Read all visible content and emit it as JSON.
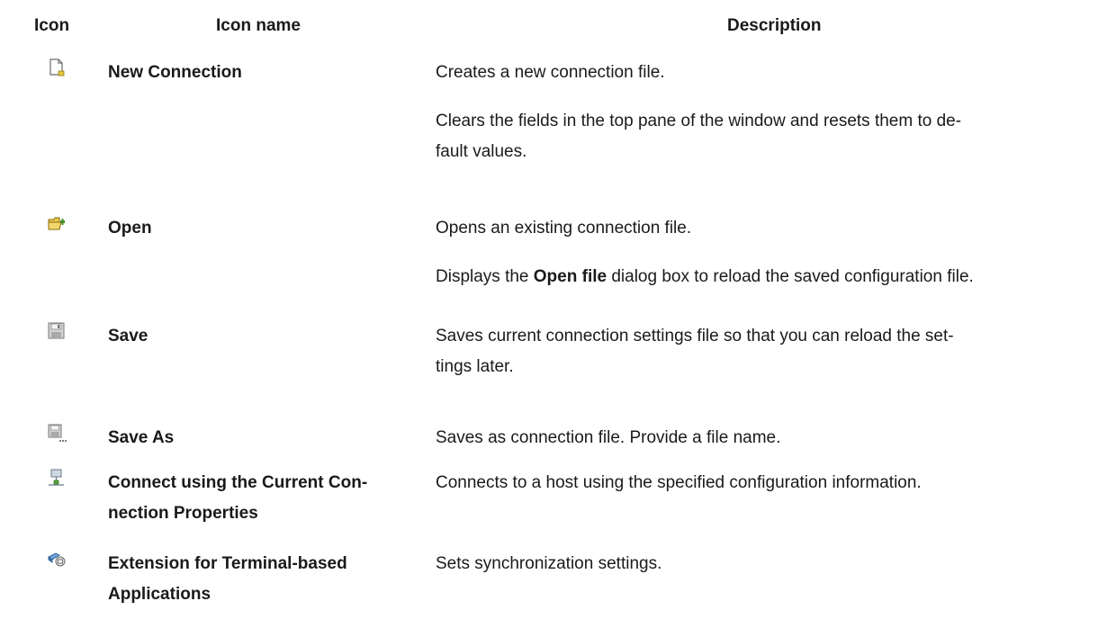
{
  "headers": {
    "icon": "Icon",
    "name": "Icon name",
    "description": "Description"
  },
  "rows": [
    {
      "icon": "new-connection-icon",
      "name_lines": [
        "New Connection"
      ],
      "desc_lines": [
        "Creates a new connection file.",
        "Clears the fields in the top pane of the window and resets them to de-",
        "fault values."
      ]
    },
    {
      "icon": "open-folder-icon",
      "name_lines": [
        "Open"
      ],
      "desc_lines": [
        "Opens an existing connection file.",
        "Displays the ",
        "Open file",
        " dialog box to reload the saved configuration file."
      ]
    },
    {
      "icon": "save-icon",
      "name_lines": [
        "Save"
      ],
      "desc_lines": [
        "Saves current connection settings file so that you can reload the set-",
        "tings later."
      ]
    },
    {
      "icon": "save-as-icon",
      "name_lines": [
        "Save As"
      ],
      "desc_lines": [
        "Saves as connection file. Provide a file name."
      ]
    },
    {
      "icon": "connect-network-icon",
      "name_lines": [
        "Connect using the Current Con-",
        "nection Properties"
      ],
      "desc_lines": [
        "Connects to a host using the specified configuration information."
      ]
    },
    {
      "icon": "extension-terminal-icon",
      "name_lines": [
        "Extension for Terminal-based",
        "Applications"
      ],
      "desc_lines": [
        "Sets synchronization settings."
      ]
    }
  ]
}
